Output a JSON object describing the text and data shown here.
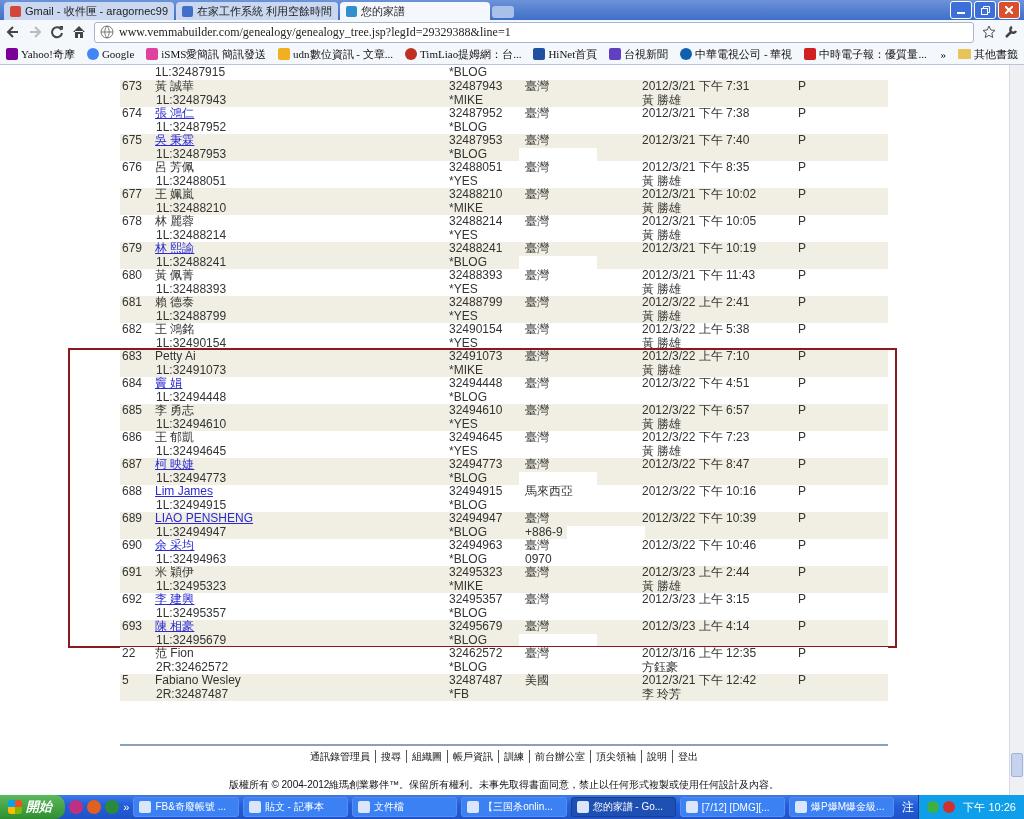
{
  "browser": {
    "tabs": [
      {
        "label": "Gmail - 收件匣 - aragornec99",
        "selected": false
      },
      {
        "label": "在家工作系統 利用空餘時間",
        "selected": false
      },
      {
        "label": "您的家譜",
        "selected": true
      }
    ],
    "url": "www.vemmabuilder.com/genealogy/genealogy_tree.jsp?legId=29329388&line=1",
    "bookmarks": [
      "Yahoo!奇摩",
      "Google",
      "iSMS愛簡訊 簡訊發送",
      "udn數位資訊 - 文章...",
      "TimLiao提姆網：台...",
      "HiNet首頁",
      "台視新聞",
      "中華電視公司 - 華視",
      "中時電子報：優質量..."
    ],
    "bookmarks_more": "»",
    "other_bookmarks": "其他書籤"
  },
  "table": {
    "sections": [
      {
        "highlighted": false,
        "rows": [
          {
            "kind": "partial",
            "code": "1L:32487915",
            "source": "*BLOG",
            "redacted": true
          },
          {
            "kind": "full",
            "no": "673",
            "name": "黃 誠華",
            "link": false,
            "code": "1L:32487943",
            "id": "32487943",
            "source": "*MIKE",
            "country": "臺灣",
            "date": "2012/3/21 下午 7:31",
            "sponsor": "黃 勝雄",
            "status": "P",
            "redacted": false
          },
          {
            "kind": "full",
            "no": "674",
            "name": "張 鴻仁",
            "link": true,
            "code": "1L:32487952",
            "id": "32487952",
            "source": "*BLOG",
            "country": "臺灣",
            "date": "2012/3/21 下午 7:38",
            "status": "P",
            "redacted": false
          },
          {
            "kind": "full",
            "no": "675",
            "name": "吳 秉霖",
            "link": true,
            "code": "1L:32487953",
            "id": "32487953",
            "source": "*BLOG",
            "country": "臺灣",
            "date": "2012/3/21 下午 7:40",
            "status": "P",
            "redacted": true
          },
          {
            "kind": "full",
            "no": "676",
            "name": "呂 芳佩",
            "link": false,
            "code": "1L:32488051",
            "id": "32488051",
            "source": "*YES",
            "country": "臺灣",
            "date": "2012/3/21 下午 8:35",
            "sponsor": "黃 勝雄",
            "status": "P",
            "redacted": false
          },
          {
            "kind": "full",
            "no": "677",
            "name": "王 姵嵐",
            "link": false,
            "code": "1L:32488210",
            "id": "32488210",
            "source": "*MIKE",
            "country": "臺灣",
            "date": "2012/3/21 下午 10:02",
            "sponsor": "黃 勝雄",
            "status": "P",
            "redacted": false
          },
          {
            "kind": "full",
            "no": "678",
            "name": "林 麗蓉",
            "link": false,
            "code": "1L:32488214",
            "id": "32488214",
            "source": "*YES",
            "country": "臺灣",
            "date": "2012/3/21 下午 10:05",
            "sponsor": "黃 勝雄",
            "status": "P",
            "redacted": false
          },
          {
            "kind": "full",
            "no": "679",
            "name": "林 熙諭",
            "link": true,
            "code": "1L:32488241",
            "id": "32488241",
            "source": "*BLOG",
            "country": "臺灣",
            "date": "2012/3/21 下午 10:19",
            "status": "P",
            "redacted": true
          },
          {
            "kind": "full",
            "no": "680",
            "name": "黃 佩菁",
            "link": false,
            "code": "1L:32488393",
            "id": "32488393",
            "source": "*YES",
            "country": "臺灣",
            "date": "2012/3/21 下午 11:43",
            "sponsor": "黃 勝雄",
            "status": "P",
            "redacted": false
          },
          {
            "kind": "full",
            "no": "681",
            "name": "賴 德泰",
            "link": false,
            "code": "1L:32488799",
            "id": "32488799",
            "source": "*YES",
            "country": "臺灣",
            "date": "2012/3/22 上午 2:41",
            "sponsor": "黃 勝雄",
            "status": "P",
            "redacted": false
          },
          {
            "kind": "full",
            "no": "682",
            "name": "王 鴻銘",
            "link": false,
            "code": "1L:32490154",
            "id": "32490154",
            "source": "*YES",
            "country": "臺灣",
            "date": "2012/3/22 上午 5:38",
            "sponsor": "黃 勝雄",
            "status": "P",
            "redacted": false
          }
        ]
      },
      {
        "highlighted": true,
        "rows": [
          {
            "kind": "full",
            "no": "683",
            "name": "Petty Ai",
            "link": false,
            "code": "1L:32491073",
            "id": "32491073",
            "source": "*MIKE",
            "country": "臺灣",
            "date": "2012/3/22 上午 7:10",
            "sponsor": "黃 勝雄",
            "status": "P",
            "redacted": false
          },
          {
            "kind": "full",
            "no": "684",
            "name": "竇 娟",
            "link": true,
            "code": "1L:32494448",
            "id": "32494448",
            "source": "*BLOG",
            "country": "臺灣",
            "date": "2012/3/22 下午 4:51",
            "status": "P",
            "redacted": true
          },
          {
            "kind": "full",
            "no": "685",
            "name": "李 勇志",
            "link": false,
            "code": "1L:32494610",
            "id": "32494610",
            "source": "*YES",
            "country": "臺灣",
            "date": "2012/3/22 下午 6:57",
            "sponsor": "黃 勝雄",
            "status": "P",
            "redacted": false
          },
          {
            "kind": "full",
            "no": "686",
            "name": "王 郁凱",
            "link": false,
            "code": "1L:32494645",
            "id": "32494645",
            "source": "*YES",
            "country": "臺灣",
            "date": "2012/3/22 下午 7:23",
            "sponsor": "黃 勝雄",
            "status": "P",
            "redacted": false
          },
          {
            "kind": "full",
            "no": "687",
            "name": "柯 映婕",
            "link": true,
            "code": "1L:32494773",
            "id": "32494773",
            "source": "*BLOG",
            "country": "臺灣",
            "date": "2012/3/22 下午 8:47",
            "status": "P",
            "redacted": true
          },
          {
            "kind": "full",
            "no": "688",
            "name": "Lim James",
            "link": true,
            "code": "1L:32494915",
            "id": "32494915",
            "source": "*BLOG",
            "country": "馬來西亞",
            "date": "2012/3/22 下午 10:16",
            "status": "P",
            "redacted": true
          },
          {
            "kind": "full",
            "no": "689",
            "name": "LIAO PENSHENG",
            "link": true,
            "code": "1L:32494947",
            "id": "32494947",
            "source": "*BLOG",
            "country": "臺灣",
            "phone": "+886-9",
            "date": "2012/3/22 下午 10:39",
            "status": "P",
            "redacted": true
          },
          {
            "kind": "full",
            "no": "690",
            "name": "余 采均",
            "link": true,
            "code": "1L:32494963",
            "id": "32494963",
            "source": "*BLOG",
            "country": "臺灣",
            "phone": "0970",
            "date": "2012/3/22 下午 10:46",
            "status": "P",
            "redacted": false
          },
          {
            "kind": "full",
            "no": "691",
            "name": "米 穎伊",
            "link": false,
            "code": "1L:32495323",
            "id": "32495323",
            "source": "*MIKE",
            "country": "臺灣",
            "date": "2012/3/23 上午 2:44",
            "sponsor": "黃 勝雄",
            "status": "P",
            "redacted": false
          },
          {
            "kind": "full",
            "no": "692",
            "name": "李 建興",
            "link": true,
            "code": "1L:32495357",
            "id": "32495357",
            "source": "*BLOG",
            "country": "臺灣",
            "date": "2012/3/23 上午 3:15",
            "status": "P",
            "redacted": true
          },
          {
            "kind": "full",
            "no": "693",
            "name": "陳 相豪",
            "link": true,
            "code": "1L:32495679",
            "id": "32495679",
            "source": "*BLOG",
            "country": "臺灣",
            "date": "2012/3/23 上午 4:14",
            "status": "P",
            "redacted": true
          }
        ]
      },
      {
        "highlighted": false,
        "rows": [
          {
            "kind": "full",
            "no": "22",
            "name": "范 Fion",
            "link": false,
            "code": "2R:32462572",
            "id": "32462572",
            "source": "*BLOG",
            "country": "臺灣",
            "date": "2012/3/16 上午 12:35",
            "sponsor": "方鈺豪",
            "status": "P",
            "redacted": false
          },
          {
            "kind": "full",
            "no": "5",
            "name": "Fabiano Wesley",
            "link": false,
            "code": "2R:32487487",
            "id": "32487487",
            "source": "*FB",
            "country": "美國",
            "date": "2012/3/21 下午 12:42",
            "sponsor": "李 玲芳",
            "status": "P",
            "redacted": false
          }
        ]
      }
    ]
  },
  "footer": {
    "links": [
      "通訊錄管理員",
      "搜尋",
      "組織圖",
      "帳戶資訊",
      "訓練",
      "前台辦公室",
      "頂尖領袖",
      "說明",
      "登出"
    ],
    "copyright": "版權所有 © 2004-2012維瑪創業夥伴™。保留所有權利。未事先取得書面同意，禁止以任何形式複製或使用任何設計及內容。"
  },
  "taskbar": {
    "start": "開始",
    "quick_more": "»",
    "tasks": [
      {
        "label": "FB&奇廢帳號 ...",
        "selected": false
      },
      {
        "label": "貼文 - 記事本",
        "selected": false
      },
      {
        "label": "文件檔",
        "selected": false
      },
      {
        "label": "【三国杀onlin...",
        "selected": false
      },
      {
        "label": "您的家譜 - Go...",
        "selected": true
      },
      {
        "label": "[7/12] [DMG][...",
        "selected": false
      },
      {
        "label": "爆P爆M爆金級...",
        "selected": false
      }
    ],
    "ime": "注",
    "clock": "下午 10:26"
  }
}
